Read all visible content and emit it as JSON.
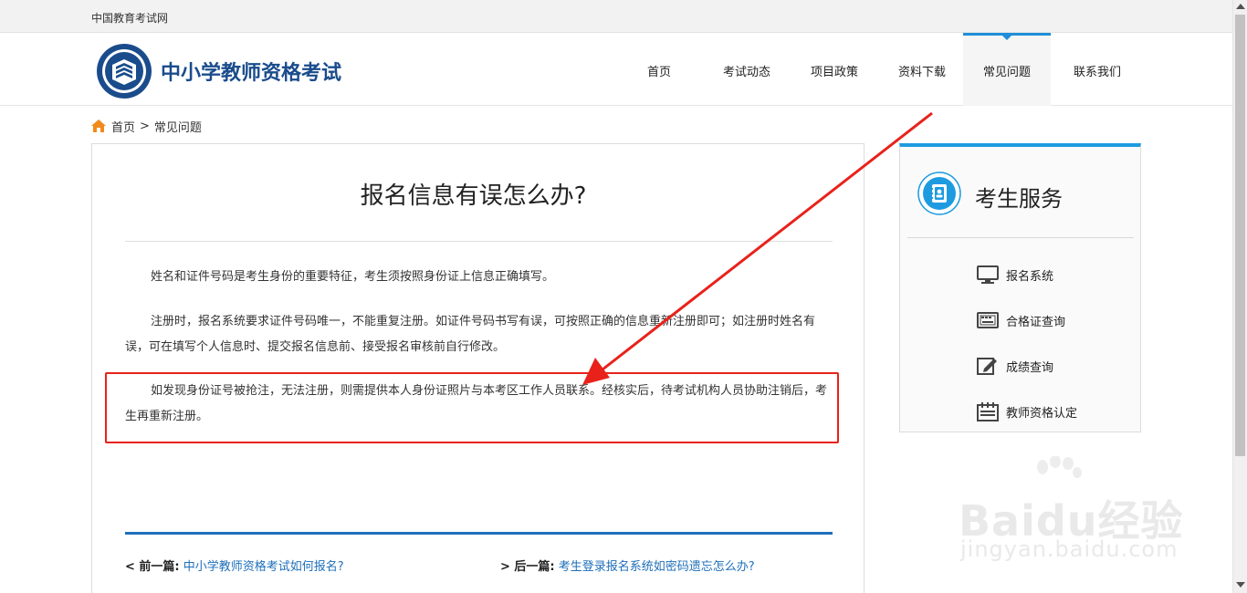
{
  "topbar": {
    "site_name": "中国教育考试网"
  },
  "header": {
    "brand": "中小学教师资格考试",
    "nav": [
      {
        "label": "首页",
        "active": false
      },
      {
        "label": "考试动态",
        "active": false
      },
      {
        "label": "项目政策",
        "active": false
      },
      {
        "label": "资料下载",
        "active": false
      },
      {
        "label": "常见问题",
        "active": true
      },
      {
        "label": "联系我们",
        "active": false
      }
    ]
  },
  "breadcrumb": {
    "home": "首页",
    "separator": ">",
    "current": "常见问题"
  },
  "article": {
    "title": "报名信息有误怎么办?",
    "paragraphs": [
      "姓名和证件号码是考生身份的重要特征，考生须按照身份证上信息正确填写。",
      "注册时，报名系统要求证件号码唯一，不能重复注册。如证件号码书写有误，可按照正确的信息重新注册即可；如注册时姓名有误，可在填写个人信息时、提交报名信息前、接受报名审核前自行修改。",
      "如发现身份证号被抢注，无法注册，则需提供本人身份证照片与本考区工作人员联系。经核实后，待考试机构人员协助注销后，考生再重新注册。"
    ],
    "prev_label": "< 前一篇:",
    "prev_link": "中小学教师资格考试如何报名?",
    "next_label": "> 后一篇:",
    "next_link": "考生登录报名系统如密码遗忘怎么办?"
  },
  "sidebar": {
    "title": "考生服务",
    "items": [
      {
        "label": "报名系统",
        "icon": "monitor-icon"
      },
      {
        "label": "合格证查询",
        "icon": "keyboard-icon"
      },
      {
        "label": "成绩查询",
        "icon": "edit-icon"
      },
      {
        "label": "教师资格认定",
        "icon": "calendar-icon"
      }
    ]
  },
  "watermark": {
    "text": "Baidu经验",
    "url": "jingyan.baidu.com"
  },
  "colors": {
    "accent": "#1e9be0",
    "brand": "#1a4c8c",
    "link": "#1e6fba",
    "annotation": "#e8221b"
  }
}
